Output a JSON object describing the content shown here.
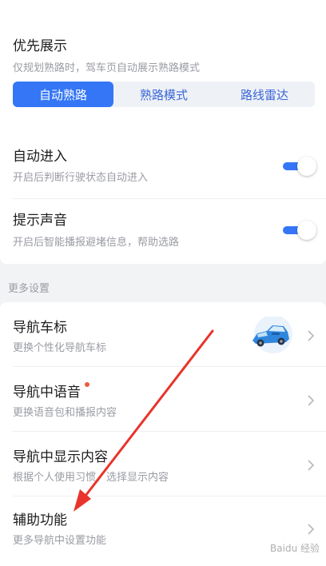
{
  "priority": {
    "title": "优先展示",
    "subtitle": "仅规划熟路时，驾车页自动展示熟路模式",
    "options": [
      "自动熟路",
      "熟路模式",
      "路线雷达"
    ],
    "selected_index": 0
  },
  "auto_enter": {
    "title": "自动进入",
    "subtitle": "开启后判断行驶状态自动进入",
    "enabled": true
  },
  "sound": {
    "title": "提示声音",
    "subtitle": "开启后智能播报避堵信息，帮助选路",
    "enabled": true
  },
  "more_settings": {
    "label": "更多设置",
    "items": [
      {
        "title": "导航车标",
        "subtitle": "更换个性化导航车标"
      },
      {
        "title": "导航中语音",
        "subtitle": "更换语音包和播报内容"
      },
      {
        "title": "导航中显示内容",
        "subtitle": "根据个人使用习惯，选择显示内容"
      },
      {
        "title": "辅助功能",
        "subtitle": "更多导航中设置功能"
      }
    ]
  },
  "watermark": "Baidu 经验",
  "colors": {
    "accent": "#3476f6",
    "annotation_arrow": "#e8342c",
    "badge_dot": "#f05a3a"
  }
}
